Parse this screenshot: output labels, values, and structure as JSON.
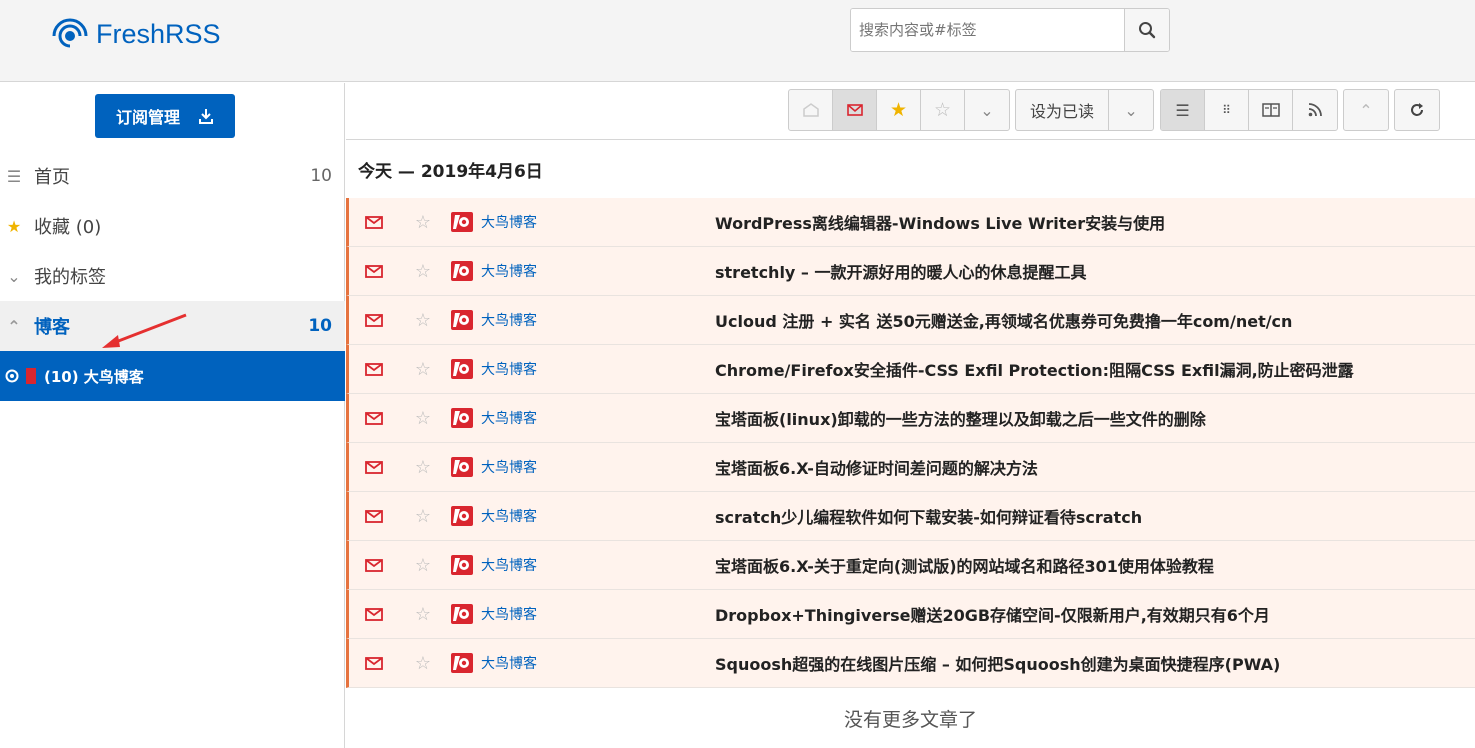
{
  "app": {
    "name": "FreshRSS"
  },
  "search": {
    "placeholder": "搜索内容或#标签"
  },
  "sidebar": {
    "subscribe_button": "订阅管理",
    "items": [
      {
        "label": "首页",
        "count": "10"
      },
      {
        "label": "收藏 (0)",
        "count": ""
      },
      {
        "label": "我的标签",
        "count": ""
      }
    ],
    "category": {
      "label": "博客",
      "count": "10"
    },
    "feed": {
      "label": "(10) 大鸟博客"
    }
  },
  "toolbar": {
    "mark_read_label": "设为已读"
  },
  "day_header": "今天 — 2019年4月6日",
  "articles": [
    {
      "feed": "大鸟博客",
      "title": "WordPress离线编辑器-Windows Live Writer安装与使用"
    },
    {
      "feed": "大鸟博客",
      "title": "stretchly – 一款开源好用的暖人心的休息提醒工具"
    },
    {
      "feed": "大鸟博客",
      "title": "Ucloud 注册 + 实名 送50元赠送金,再领域名优惠券可免费撸一年com/net/cn"
    },
    {
      "feed": "大鸟博客",
      "title": "Chrome/Firefox安全插件-CSS Exfil Protection:阻隔CSS Exfil漏洞,防止密码泄露"
    },
    {
      "feed": "大鸟博客",
      "title": "宝塔面板(linux)卸载的一些方法的整理以及卸载之后一些文件的删除"
    },
    {
      "feed": "大鸟博客",
      "title": "宝塔面板6.X-自动修证时间差问题的解决方法"
    },
    {
      "feed": "大鸟博客",
      "title": "scratch少儿编程软件如何下载安装-如何辩证看待scratch"
    },
    {
      "feed": "大鸟博客",
      "title": "宝塔面板6.X-关于重定向(测试版)的网站域名和路径301使用体验教程"
    },
    {
      "feed": "大鸟博客",
      "title": "Dropbox+Thingiverse赠送20GB存储空间-仅限新用户,有效期只有6个月"
    },
    {
      "feed": "大鸟博客",
      "title": "Squoosh超强的在线图片压缩 – 如何把Squoosh创建为桌面快捷程序(PWA)"
    }
  ],
  "footer": {
    "no_more": "没有更多文章了"
  },
  "colors": {
    "brand": "#0062be",
    "unread_bg": "#fff3ed",
    "unread_border": "#e6733f",
    "mail_red": "#d9262f"
  }
}
